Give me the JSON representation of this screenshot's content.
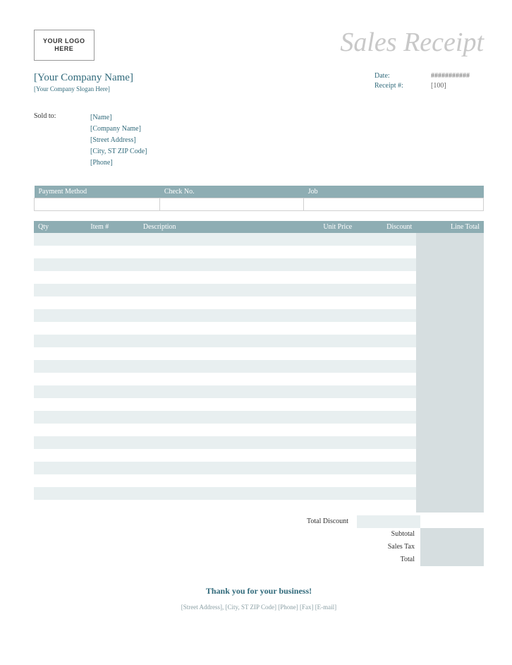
{
  "title": "Sales Receipt",
  "logo": {
    "line1": "YOUR LOGO",
    "line2": "HERE"
  },
  "company": {
    "name": "[Your Company Name]",
    "slogan": "[Your Company Slogan Here]"
  },
  "meta": {
    "date_label": "Date:",
    "date_value": "###########",
    "receipt_label": "Receipt #:",
    "receipt_value": "[100]"
  },
  "soldto": {
    "label": "Sold to:",
    "name": "[Name]",
    "company": "[Company Name]",
    "street": "[Street Address]",
    "city": "[City, ST  ZIP Code]",
    "phone": "[Phone]"
  },
  "payment_headers": {
    "method": "Payment Method",
    "check": "Check No.",
    "job": "Job"
  },
  "payment_row": {
    "method": "",
    "check": "",
    "job": ""
  },
  "items_headers": {
    "qty": "Qty",
    "item": "Item #",
    "desc": "Description",
    "unit": "Unit Price",
    "disc": "Discount",
    "line": "Line Total"
  },
  "item_row_count": 22,
  "totals": {
    "total_discount": "Total Discount",
    "subtotal": "Subtotal",
    "sales_tax": "Sales Tax",
    "total": "Total"
  },
  "thankyou": "Thank you for your business!",
  "footer": "[Street Address], [City, ST  ZIP Code]  [Phone]  [Fax]  [E-mail]"
}
